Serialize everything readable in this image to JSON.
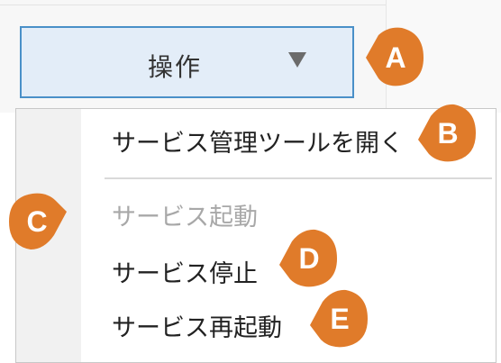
{
  "operation_button": {
    "label": "操作",
    "caret_icon": "caret-down-icon"
  },
  "menu": {
    "items": [
      {
        "label": "サービス管理ツールを開く",
        "enabled": true
      },
      {
        "label": "サービス起動",
        "enabled": false
      },
      {
        "label": "サービス停止",
        "enabled": true
      },
      {
        "label": "サービス再起動",
        "enabled": true
      }
    ]
  },
  "callouts": [
    "A",
    "B",
    "C",
    "D",
    "E"
  ],
  "colors": {
    "callout": "#e07b2a",
    "button_border": "#4a90c8",
    "button_bg": "#e3edf8",
    "disabled_text": "#a8a8a8"
  }
}
